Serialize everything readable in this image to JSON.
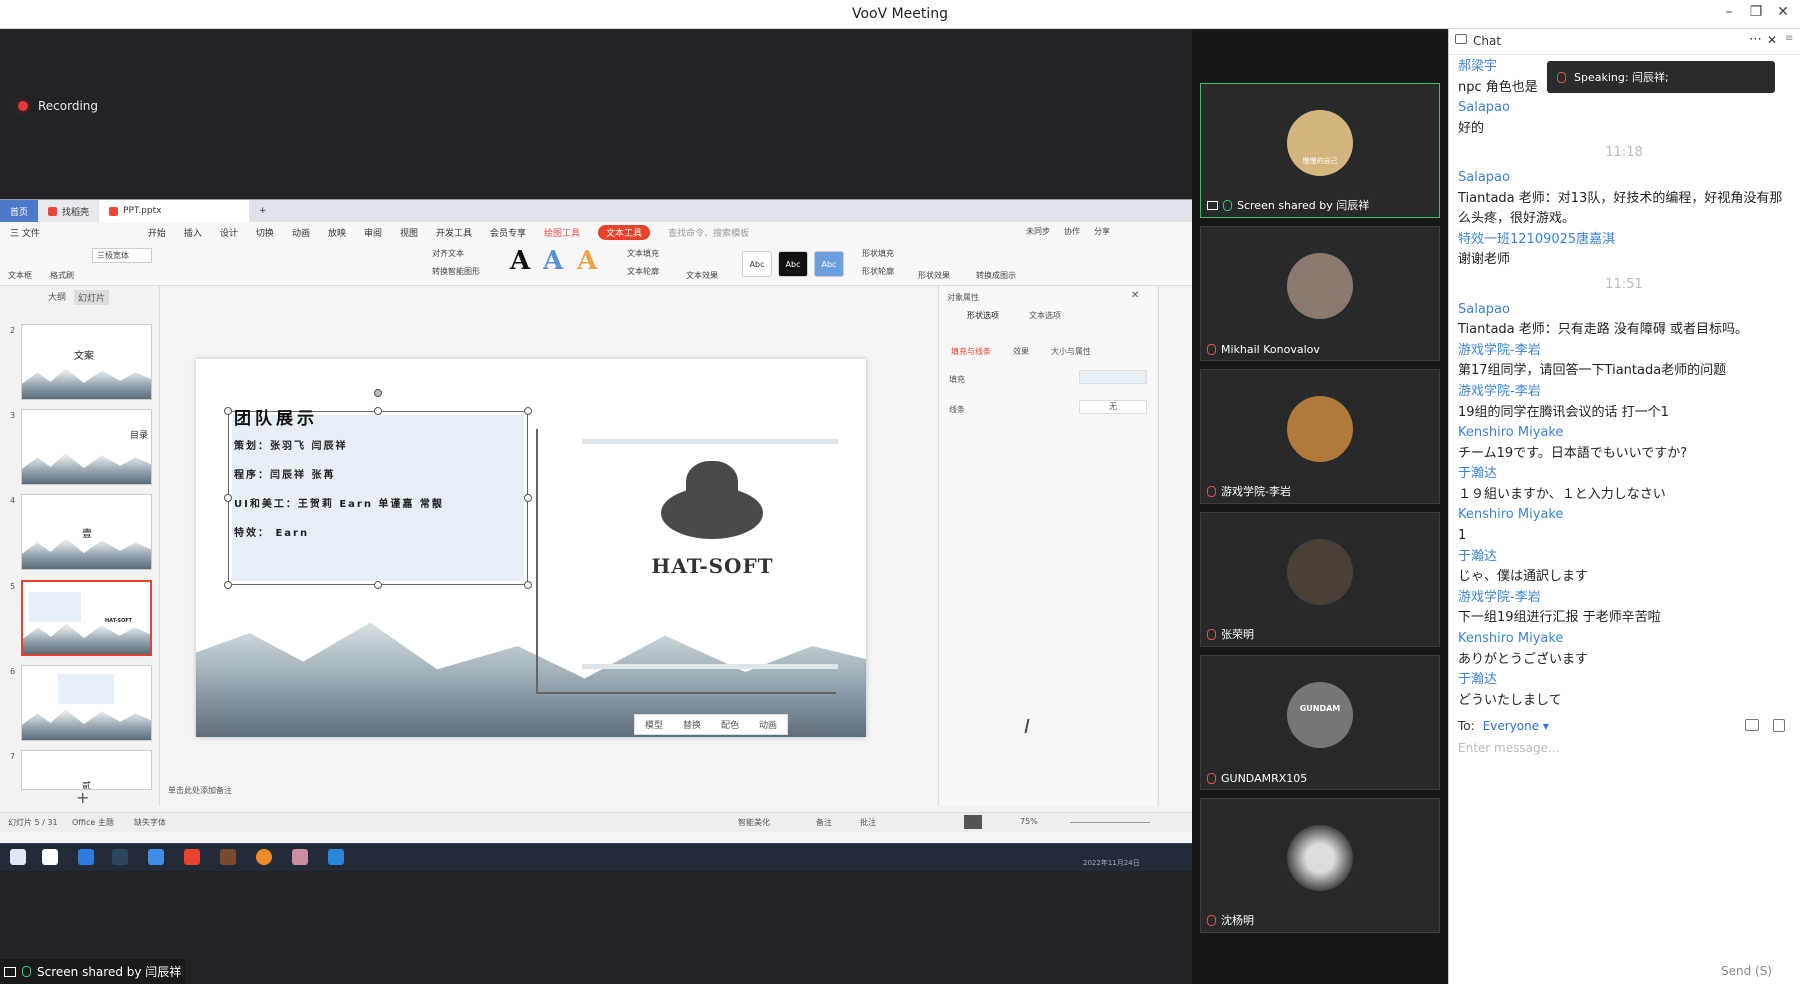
{
  "window": {
    "title": "VooV Meeting"
  },
  "recording": {
    "label": "Recording"
  },
  "ppt": {
    "tabs": [
      "首页",
      "找稻壳",
      "PPT.pptx"
    ],
    "menu": [
      "三 文件",
      "开始",
      "插入",
      "设计",
      "切换",
      "动画",
      "放映",
      "审阅",
      "视图",
      "开发工具",
      "会员专享",
      "绘图工具",
      "文本工具",
      "查找命令、搜索模板"
    ],
    "ribbon": {
      "textbox": "文本框",
      "format_brush": "格式刷",
      "font": "三极宽体",
      "align_text": "对齐文本",
      "convert_art": "转换智能图形",
      "text_fill": "文本填充",
      "text_outline": "文本轮廓",
      "text_effect": "文本效果",
      "shape_fill": "形状填充",
      "shape_outline": "形状轮廓",
      "shape_effect": "形状效果",
      "convert_shape": "转换成图示",
      "styles": [
        "Abc",
        "Abc",
        "Abc"
      ],
      "top_right": [
        "未同步",
        "协作",
        "分享"
      ]
    },
    "left_tabs": [
      "大纲",
      "幻灯片"
    ],
    "slide_numbers": [
      "2",
      "3",
      "4",
      "5",
      "6",
      "7"
    ],
    "thumb_texts": [
      "文案",
      "目录",
      "壹",
      "HAT-SOFT",
      "",
      "贰"
    ],
    "slide": {
      "title": "团队展示",
      "lines": [
        "策划：张羽飞  闫辰祥",
        "程序：闫辰祥  张苒",
        "UI和美工：王贺莉  Earn  单谨嘉  常靓",
        "特效：  Earn"
      ],
      "brand": "HAT-SOFT"
    },
    "float_bar": [
      "模型",
      "替换",
      "配色",
      "动画"
    ],
    "add_notes": "单击此处添加备注",
    "right_panel": {
      "title": "对象属性",
      "tab1": "形状选项",
      "tab2": "文本选项",
      "sub1": "填充与线条",
      "sub2": "效果",
      "sub3": "大小与属性",
      "fill": "填充",
      "line": "线条",
      "line_value": "无"
    },
    "status": {
      "slide_count": "幻灯片 5 / 31",
      "theme": "Office 主题",
      "missing_font": "缺失字体",
      "smart": "智能美化",
      "notes": "备注",
      "comments": "批注",
      "zoom": "75%"
    },
    "clock": {
      "date": "2022年11月24日"
    }
  },
  "share_label": "Screen shared by 闫辰祥",
  "participants": [
    {
      "name": "Screen shared by 闫辰祥",
      "avatar_color": "#c9a56b",
      "avatar_text": "慢慢的自己"
    },
    {
      "name": "Mikhail Konovalov",
      "avatar_color": "#8a7a70",
      "avatar_text": ""
    },
    {
      "name": "游戏学院-李岩",
      "avatar_color": "#b07a3a",
      "avatar_text": ""
    },
    {
      "name": "张荣明",
      "avatar_color": "#4a4036",
      "avatar_text": ""
    },
    {
      "name": "GUNDAMRX105",
      "avatar_color": "#777",
      "avatar_text": "GUNDAM"
    },
    {
      "name": "沈杨明",
      "avatar_color": "#c9c9c9",
      "avatar_text": ""
    }
  ],
  "chat": {
    "header": "Chat",
    "speaking": "Speaking: 闫辰祥;",
    "messages": [
      {
        "sender": "郝梁宇",
        "text": "npc 角色也是"
      },
      {
        "sender": "Salapao",
        "text": "好的"
      },
      {
        "time": "11:18"
      },
      {
        "sender": "Salapao",
        "text": "Tiantada 老师：对13队，好技术的编程，好视角没有那么头疼，很好游戏。"
      },
      {
        "sender": "特效一班12109025唐嘉淇",
        "text": "谢谢老师"
      },
      {
        "time": "11:51"
      },
      {
        "sender": "Salapao",
        "text": "Tiantada 老师：只有走路 没有障碍 或者目标吗。"
      },
      {
        "sender": "游戏学院-李岩",
        "text": "第17组同学，请回答一下Tiantada老师的问题"
      },
      {
        "sender": "游戏学院-李岩",
        "text": "19组的同学在腾讯会议的话 打一个1"
      },
      {
        "sender": "Kenshiro Miyake",
        "text": "チーム19です。日本語でもいいですか?"
      },
      {
        "sender": "于瀚达",
        "text": "１９組いますか、１と入力しなさい"
      },
      {
        "sender": "Kenshiro Miyake",
        "text": "1"
      },
      {
        "sender": "于瀚达",
        "text": "じゃ、僕は通訳します"
      },
      {
        "sender": "游戏学院-李岩",
        "text": "下一组19组进行汇报 于老师辛苦啦"
      },
      {
        "sender": "Kenshiro Miyake",
        "text": "ありがとうございます"
      },
      {
        "sender": "于瀚达",
        "text": "どういたしまして"
      }
    ],
    "to_label": "To:",
    "to_value": "Everyone ▾",
    "input_placeholder": "Enter message...",
    "send": "Send (S)"
  }
}
